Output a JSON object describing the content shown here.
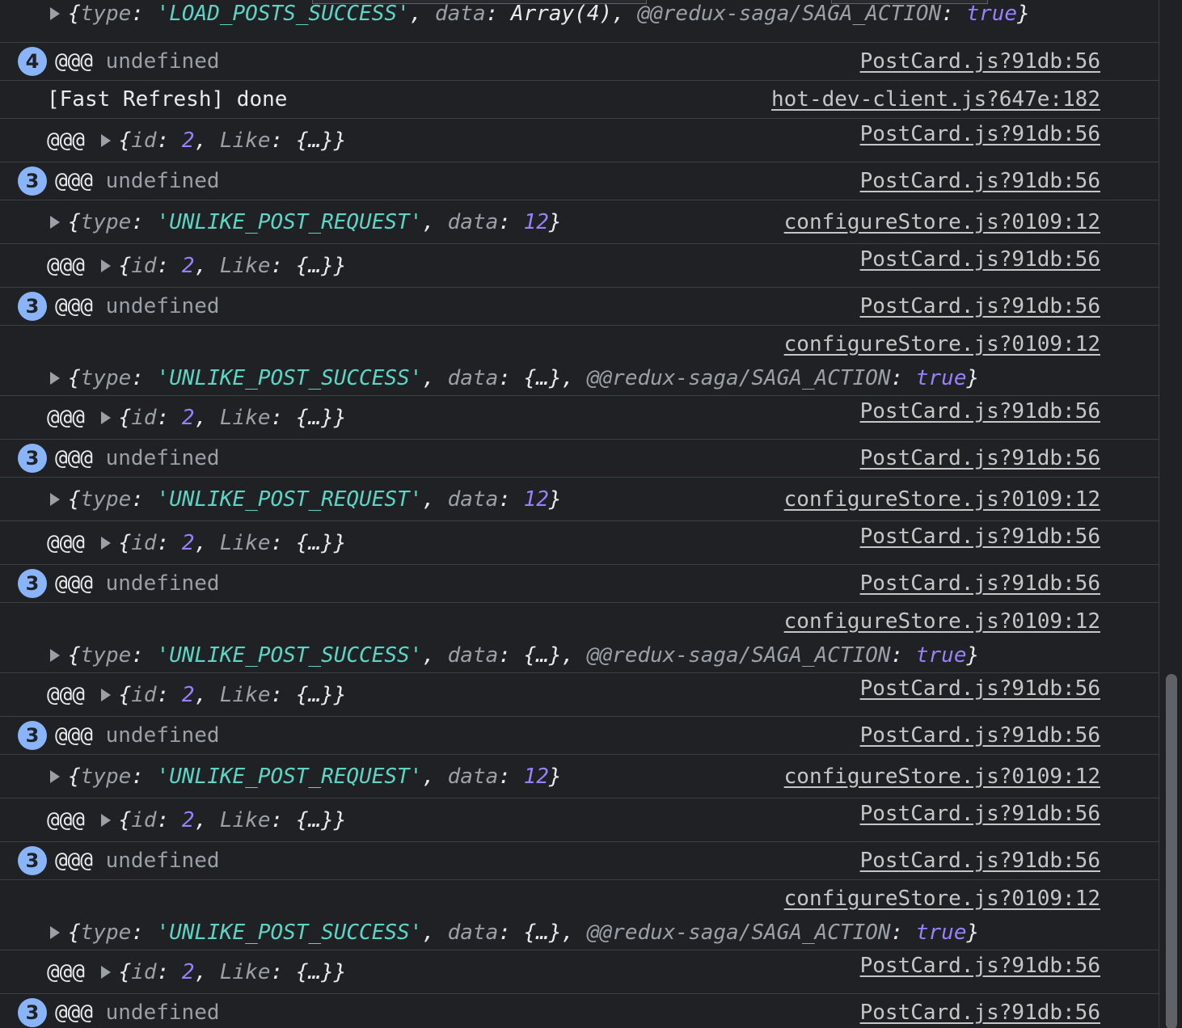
{
  "colors": {
    "background": "#202124",
    "badge": "#8ab4f8",
    "string": "#5cd5c5",
    "number": "#9980ff",
    "key": "#9aa0a6",
    "separator": "#3c4043"
  },
  "tokens": {
    "at": "@@@",
    "undef": "undefined",
    "type_key": "type",
    "data_key": "data",
    "id_key": "id",
    "like_key": "Like",
    "saga_key": "@@redux-saga/SAGA_ACTION",
    "true_val": "true",
    "ellipsis_obj": "{…}",
    "id_val": "2",
    "req_val": "12",
    "open": "{",
    "close": "}",
    "colon": ": ",
    "comma": ", "
  },
  "rows": [
    {
      "kind": "action",
      "action": "'LOAD_POSTS_SUCCESS'",
      "data": "Array(4)",
      "saga": true,
      "source": ""
    },
    {
      "kind": "undef",
      "count": "4",
      "source": "PostCard.js?91db:56"
    },
    {
      "kind": "text",
      "text": "[Fast Refresh] done",
      "source": "hot-dev-client.js?647e:182"
    },
    {
      "kind": "idlike",
      "source": "PostCard.js?91db:56"
    },
    {
      "kind": "undef",
      "count": "3",
      "source": "PostCard.js?91db:56"
    },
    {
      "kind": "action",
      "action": "'UNLIKE_POST_REQUEST'",
      "data": "12",
      "saga": false,
      "source": "configureStore.js?0109:12"
    },
    {
      "kind": "idlike",
      "source": "PostCard.js?91db:56"
    },
    {
      "kind": "undef",
      "count": "3",
      "source": "PostCard.js?91db:56"
    },
    {
      "kind": "action",
      "action": "'UNLIKE_POST_SUCCESS'",
      "data": "{…}",
      "saga": true,
      "source": "configureStore.js?0109:12"
    },
    {
      "kind": "idlike",
      "source": "PostCard.js?91db:56"
    },
    {
      "kind": "undef",
      "count": "3",
      "source": "PostCard.js?91db:56"
    },
    {
      "kind": "action",
      "action": "'UNLIKE_POST_REQUEST'",
      "data": "12",
      "saga": false,
      "source": "configureStore.js?0109:12"
    },
    {
      "kind": "idlike",
      "source": "PostCard.js?91db:56"
    },
    {
      "kind": "undef",
      "count": "3",
      "source": "PostCard.js?91db:56"
    },
    {
      "kind": "action",
      "action": "'UNLIKE_POST_SUCCESS'",
      "data": "{…}",
      "saga": true,
      "source": "configureStore.js?0109:12"
    },
    {
      "kind": "idlike",
      "source": "PostCard.js?91db:56"
    },
    {
      "kind": "undef",
      "count": "3",
      "source": "PostCard.js?91db:56"
    },
    {
      "kind": "action",
      "action": "'UNLIKE_POST_REQUEST'",
      "data": "12",
      "saga": false,
      "source": "configureStore.js?0109:12"
    },
    {
      "kind": "idlike",
      "source": "PostCard.js?91db:56"
    },
    {
      "kind": "undef",
      "count": "3",
      "source": "PostCard.js?91db:56"
    },
    {
      "kind": "action",
      "action": "'UNLIKE_POST_SUCCESS'",
      "data": "{…}",
      "saga": true,
      "source": "configureStore.js?0109:12"
    },
    {
      "kind": "idlike",
      "source": "PostCard.js?91db:56"
    },
    {
      "kind": "undef",
      "count": "3",
      "source": "PostCard.js?91db:56"
    }
  ]
}
